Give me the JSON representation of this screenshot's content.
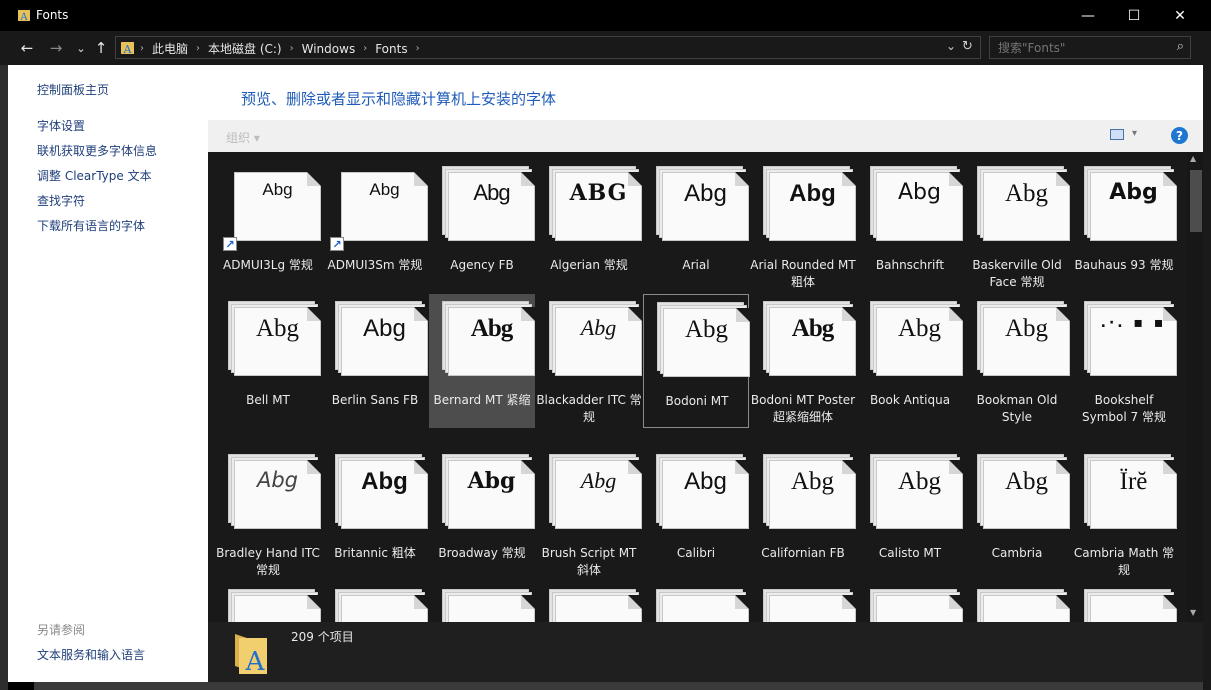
{
  "window": {
    "title": "Fonts",
    "controls": {
      "minimize": "—",
      "maximize": "☐",
      "close": "✕"
    }
  },
  "nav": {
    "back": "←",
    "forward": "→",
    "recent": "⌄",
    "up": "↑"
  },
  "breadcrumbs": [
    "此电脑",
    "本地磁盘 (C:)",
    "Windows",
    "Fonts"
  ],
  "address_dropdown": "⌄",
  "refresh": "↻",
  "search": {
    "placeholder": "搜索\"Fonts\"",
    "icon": "⌕"
  },
  "left_panel": {
    "home_link": "控制面板主页",
    "links": [
      "字体设置",
      "联机获取更多字体信息",
      "调整 ClearType 文本",
      "查找字符",
      "下载所有语言的字体"
    ],
    "see_also_title": "另请参阅",
    "see_also_links": [
      "文本服务和输入语言"
    ]
  },
  "main": {
    "heading": "预览、删除或者显示和隐藏计算机上安装的字体",
    "toolbar": {
      "organize_label": "组织 ▾",
      "view_dropdown": "▾",
      "help": "?"
    }
  },
  "fonts": [
    {
      "name": "ADMUI3Lg 常规",
      "sample": "Abg",
      "shortcut": true,
      "family": "small"
    },
    {
      "name": "ADMUI3Sm 常规",
      "sample": "Abg",
      "shortcut": true,
      "family": "small"
    },
    {
      "name": "Agency FB",
      "sample": "Abg",
      "family": "condensed"
    },
    {
      "name": "Algerian 常规",
      "sample": "ABG",
      "family": "algerian"
    },
    {
      "name": "Arial",
      "sample": "Abg",
      "family": "sans"
    },
    {
      "name": "Arial Rounded MT 粗体",
      "sample": "Abg",
      "family": "sans-bold"
    },
    {
      "name": "Bahnschrift",
      "sample": "Abg",
      "family": "sans-light"
    },
    {
      "name": "Baskerville Old Face 常规",
      "sample": "Abg",
      "family": "serif"
    },
    {
      "name": "Bauhaus 93 常规",
      "sample": "Abg",
      "family": "bauhaus"
    },
    {
      "name": "Bell MT",
      "sample": "Abg",
      "family": "serif"
    },
    {
      "name": "Berlin Sans FB",
      "sample": "Abg",
      "family": "sans"
    },
    {
      "name": "Bernard MT 紧缩",
      "sample": "Abg",
      "family": "serif-bold-cond"
    },
    {
      "name": "Blackadder ITC 常规",
      "sample": "Abg",
      "family": "script"
    },
    {
      "name": "Bodoni MT",
      "sample": "Abg",
      "family": "serif"
    },
    {
      "name": "Bodoni MT Poster 超紧缩细体",
      "sample": "Abg",
      "family": "serif-bold-cond"
    },
    {
      "name": "Book Antiqua",
      "sample": "Abg",
      "family": "serif"
    },
    {
      "name": "Bookman Old Style",
      "sample": "Abg",
      "family": "serif"
    },
    {
      "name": "Bookshelf Symbol 7 常规",
      "sample": ".·. ▪ ▪",
      "family": "symbol"
    },
    {
      "name": "Bradley Hand ITC 常规",
      "sample": "Abg",
      "family": "script-light"
    },
    {
      "name": "Britannic 粗体",
      "sample": "Abg",
      "family": "sans-bold"
    },
    {
      "name": "Broadway 常规",
      "sample": "Abg",
      "family": "broadway"
    },
    {
      "name": "Brush Script MT 斜体",
      "sample": "Abg",
      "family": "script"
    },
    {
      "name": "Calibri",
      "sample": "Abg",
      "family": "sans"
    },
    {
      "name": "Californian FB",
      "sample": "Abg",
      "family": "serif"
    },
    {
      "name": "Calisto MT",
      "sample": "Abg",
      "family": "serif"
    },
    {
      "name": "Cambria",
      "sample": "Abg",
      "family": "serif"
    },
    {
      "name": "Cambria Math 常规",
      "sample": "Ïrĕ",
      "family": "serif"
    }
  ],
  "selected_font": "Bernard MT 紧缩",
  "focused_font": "Bodoni MT",
  "status": {
    "item_count": "209 个项目"
  }
}
